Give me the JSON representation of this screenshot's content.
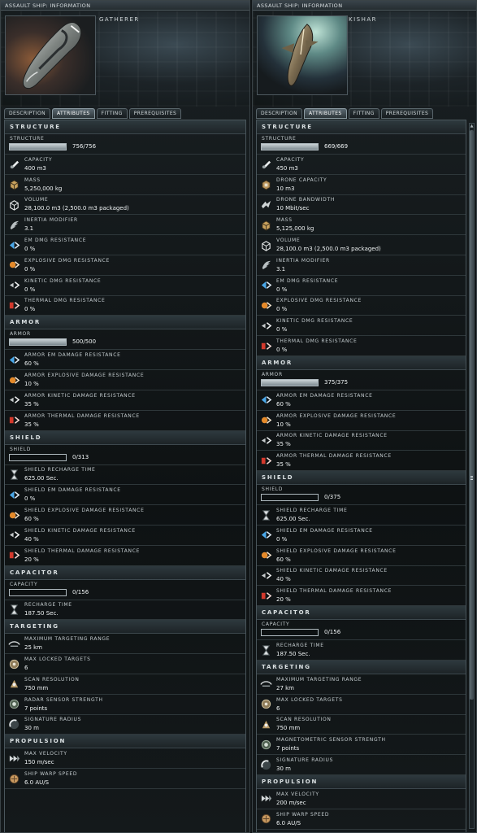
{
  "windows": [
    {
      "title": "ASSAULT SHIP: INFORMATION",
      "ship_name": "GATHERER",
      "tabs": [
        "DESCRIPTION",
        "ATTRIBUTES",
        "FITTING",
        "PREREQUISITES"
      ],
      "active_tab": "ATTRIBUTES",
      "sections": [
        {
          "title": "STRUCTURE",
          "bar": {
            "label": "STRUCTURE",
            "value": "756/756",
            "fill": 1.0
          },
          "rows": [
            {
              "icon": "cargo-icon",
              "label": "CAPACITY",
              "value": "400 m3"
            },
            {
              "icon": "mass-icon",
              "label": "MASS",
              "value": "5,250,000 kg"
            },
            {
              "icon": "volume-icon",
              "label": "VOLUME",
              "value": "28,100.0 m3  (2,500.0 m3 packaged)"
            },
            {
              "icon": "inertia-icon",
              "label": "INERTIA MODIFIER",
              "value": "3.1"
            },
            {
              "icon": "em-resist-icon",
              "label": "EM DMG RESISTANCE",
              "value": "0 %"
            },
            {
              "icon": "explosive-resist-icon",
              "label": "EXPLOSIVE DMG RESISTANCE",
              "value": "0 %"
            },
            {
              "icon": "kinetic-resist-icon",
              "label": "KINETIC DMG RESISTANCE",
              "value": "0 %"
            },
            {
              "icon": "thermal-resist-icon",
              "label": "THERMAL DMG RESISTANCE",
              "value": "0 %"
            }
          ]
        },
        {
          "title": "ARMOR",
          "bar": {
            "label": "ARMOR",
            "value": "500/500",
            "fill": 1.0
          },
          "rows": [
            {
              "icon": "em-resist-icon",
              "label": "ARMOR EM DAMAGE RESISTANCE",
              "value": "60 %"
            },
            {
              "icon": "explosive-resist-icon",
              "label": "ARMOR EXPLOSIVE DAMAGE RESISTANCE",
              "value": "10 %"
            },
            {
              "icon": "kinetic-resist-icon",
              "label": "ARMOR KINETIC DAMAGE RESISTANCE",
              "value": "35 %"
            },
            {
              "icon": "thermal-resist-icon",
              "label": "ARMOR THERMAL DAMAGE RESISTANCE",
              "value": "35 %"
            }
          ]
        },
        {
          "title": "SHIELD",
          "bar": {
            "label": "SHIELD",
            "value": "0/313",
            "fill": 0
          },
          "rows": [
            {
              "icon": "hourglass-icon",
              "label": "SHIELD RECHARGE TIME",
              "value": "625.00 Sec."
            },
            {
              "icon": "em-resist-icon",
              "label": "SHIELD EM DAMAGE RESISTANCE",
              "value": "0 %"
            },
            {
              "icon": "explosive-resist-icon",
              "label": "SHIELD EXPLOSIVE DAMAGE RESISTANCE",
              "value": "60 %"
            },
            {
              "icon": "kinetic-resist-icon",
              "label": "SHIELD KINETIC DAMAGE RESISTANCE",
              "value": "40 %"
            },
            {
              "icon": "thermal-resist-icon",
              "label": "SHIELD THERMAL DAMAGE RESISTANCE",
              "value": "20 %"
            }
          ]
        },
        {
          "title": "CAPACITOR",
          "bar": {
            "label": "CAPACITY",
            "value": "0/156",
            "fill": 0
          },
          "rows": [
            {
              "icon": "hourglass-icon",
              "label": "RECHARGE TIME",
              "value": "187.50 Sec."
            }
          ]
        },
        {
          "title": "TARGETING",
          "rows": [
            {
              "icon": "targeting-range-icon",
              "label": "MAXIMUM TARGETING RANGE",
              "value": "25 km"
            },
            {
              "icon": "locked-targets-icon",
              "label": "MAX LOCKED TARGETS",
              "value": "6"
            },
            {
              "icon": "scan-resolution-icon",
              "label": "SCAN RESOLUTION",
              "value": "750 mm"
            },
            {
              "icon": "sensor-strength-icon",
              "label": "RADAR SENSOR STRENGTH",
              "value": "7 points"
            },
            {
              "icon": "signature-radius-icon",
              "label": "SIGNATURE RADIUS",
              "value": "30 m"
            }
          ]
        },
        {
          "title": "PROPULSION",
          "rows": [
            {
              "icon": "velocity-icon",
              "label": "MAX VELOCITY",
              "value": "150 m/sec"
            },
            {
              "icon": "warp-speed-icon",
              "label": "SHIP WARP SPEED",
              "value": "6.0 AU/S"
            }
          ]
        }
      ]
    },
    {
      "title": "ASSAULT SHIP: INFORMATION",
      "ship_name": "KISHAR",
      "tabs": [
        "DESCRIPTION",
        "ATTRIBUTES",
        "FITTING",
        "PREREQUISITES"
      ],
      "active_tab": "ATTRIBUTES",
      "sections": [
        {
          "title": "STRUCTURE",
          "bar": {
            "label": "STRUCTURE",
            "value": "669/669",
            "fill": 1.0
          },
          "rows": [
            {
              "icon": "cargo-icon",
              "label": "CAPACITY",
              "value": "450 m3"
            },
            {
              "icon": "drone-bay-icon",
              "label": "DRONE CAPACITY",
              "value": "10 m3"
            },
            {
              "icon": "drone-bandwidth-icon",
              "label": "DRONE BANDWIDTH",
              "value": "10 Mbit/sec"
            },
            {
              "icon": "mass-icon",
              "label": "MASS",
              "value": "5,125,000 kg"
            },
            {
              "icon": "volume-icon",
              "label": "VOLUME",
              "value": "28,100.0 m3  (2,500.0 m3 packaged)"
            },
            {
              "icon": "inertia-icon",
              "label": "INERTIA MODIFIER",
              "value": "3.1"
            },
            {
              "icon": "em-resist-icon",
              "label": "EM DMG RESISTANCE",
              "value": "0 %"
            },
            {
              "icon": "explosive-resist-icon",
              "label": "EXPLOSIVE DMG RESISTANCE",
              "value": "0 %"
            },
            {
              "icon": "kinetic-resist-icon",
              "label": "KINETIC DMG RESISTANCE",
              "value": "0 %"
            },
            {
              "icon": "thermal-resist-icon",
              "label": "THERMAL DMG RESISTANCE",
              "value": "0 %"
            }
          ]
        },
        {
          "title": "ARMOR",
          "bar": {
            "label": "ARMOR",
            "value": "375/375",
            "fill": 1.0
          },
          "rows": [
            {
              "icon": "em-resist-icon",
              "label": "ARMOR EM DAMAGE RESISTANCE",
              "value": "60 %"
            },
            {
              "icon": "explosive-resist-icon",
              "label": "ARMOR EXPLOSIVE DAMAGE RESISTANCE",
              "value": "10 %"
            },
            {
              "icon": "kinetic-resist-icon",
              "label": "ARMOR KINETIC DAMAGE RESISTANCE",
              "value": "35 %"
            },
            {
              "icon": "thermal-resist-icon",
              "label": "ARMOR THERMAL DAMAGE RESISTANCE",
              "value": "35 %"
            }
          ]
        },
        {
          "title": "SHIELD",
          "bar": {
            "label": "SHIELD",
            "value": "0/375",
            "fill": 0
          },
          "rows": [
            {
              "icon": "hourglass-icon",
              "label": "SHIELD RECHARGE TIME",
              "value": "625.00 Sec."
            },
            {
              "icon": "em-resist-icon",
              "label": "SHIELD EM DAMAGE RESISTANCE",
              "value": "0 %"
            },
            {
              "icon": "explosive-resist-icon",
              "label": "SHIELD EXPLOSIVE DAMAGE RESISTANCE",
              "value": "60 %"
            },
            {
              "icon": "kinetic-resist-icon",
              "label": "SHIELD KINETIC DAMAGE RESISTANCE",
              "value": "40 %"
            },
            {
              "icon": "thermal-resist-icon",
              "label": "SHIELD THERMAL DAMAGE RESISTANCE",
              "value": "20 %"
            }
          ]
        },
        {
          "title": "CAPACITOR",
          "bar": {
            "label": "CAPACITY",
            "value": "0/156",
            "fill": 0
          },
          "rows": [
            {
              "icon": "hourglass-icon",
              "label": "RECHARGE TIME",
              "value": "187.50 Sec."
            }
          ]
        },
        {
          "title": "TARGETING",
          "rows": [
            {
              "icon": "targeting-range-icon",
              "label": "MAXIMUM TARGETING RANGE",
              "value": "27 km"
            },
            {
              "icon": "locked-targets-icon",
              "label": "MAX LOCKED TARGETS",
              "value": "6"
            },
            {
              "icon": "scan-resolution-icon",
              "label": "SCAN RESOLUTION",
              "value": "750 mm"
            },
            {
              "icon": "sensor-strength-icon",
              "label": "MAGNETOMETRIC SENSOR STRENGTH",
              "value": "7 points"
            },
            {
              "icon": "signature-radius-icon",
              "label": "SIGNATURE RADIUS",
              "value": "30 m"
            }
          ]
        },
        {
          "title": "PROPULSION",
          "rows": [
            {
              "icon": "velocity-icon",
              "label": "MAX VELOCITY",
              "value": "200 m/sec"
            },
            {
              "icon": "warp-speed-icon",
              "label": "SHIP WARP SPEED",
              "value": "6.0 AU/S"
            }
          ]
        }
      ]
    }
  ]
}
